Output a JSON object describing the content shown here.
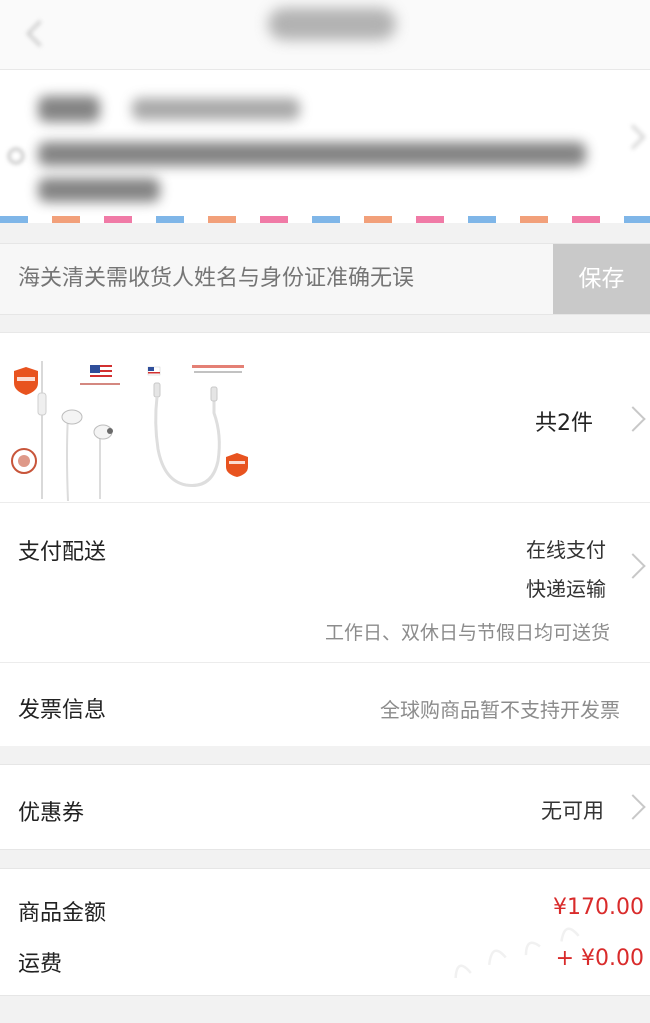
{
  "header": {
    "back_icon": "back-arrow-icon"
  },
  "address": {
    "pin_icon": "location-pin-icon",
    "chevron_icon": "chevron-right-icon"
  },
  "id_verification": {
    "placeholder": "海关清关需收货人姓名与身份证准确无误",
    "save_label": "保存"
  },
  "product": {
    "count_label": "共2件",
    "chevron_icon": "chevron-right-icon"
  },
  "payment": {
    "label": "支付配送",
    "method": "在线支付",
    "delivery": "快递运输",
    "delivery_note": "工作日、双休日与节假日均可送货"
  },
  "invoice": {
    "label": "发票信息",
    "value": "全球购商品暂不支持开发票"
  },
  "coupon": {
    "label": "优惠券",
    "value": "无可用"
  },
  "amounts": {
    "subtotal_label": "商品金额",
    "subtotal_value": "¥170.00",
    "shipping_label": "运费",
    "shipping_value": "+ ¥0.00"
  },
  "colors": {
    "price_red": "#d92b2b",
    "save_gray": "#c9c9c9"
  }
}
